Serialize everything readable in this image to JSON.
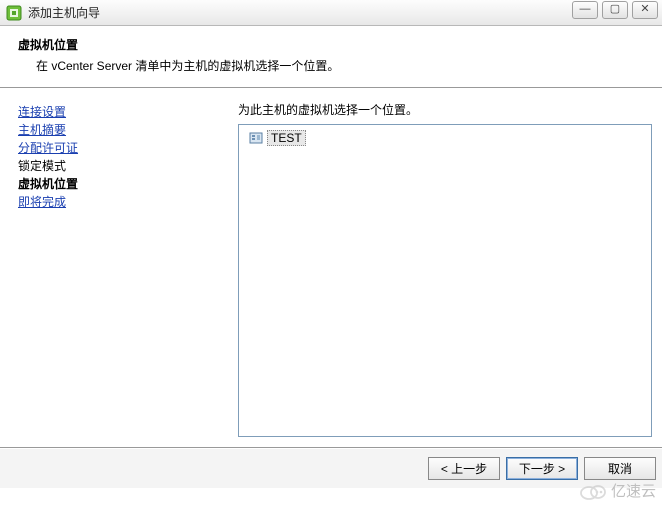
{
  "window": {
    "title": "添加主机向导",
    "controls": {
      "min": "—",
      "max": "▢",
      "close": "✕"
    }
  },
  "header": {
    "title": "虚拟机位置",
    "desc": "在 vCenter Server 清单中为主机的虚拟机选择一个位置。"
  },
  "sidebar": {
    "steps": [
      {
        "label": "连接设置",
        "state": "link"
      },
      {
        "label": "主机摘要",
        "state": "link"
      },
      {
        "label": "分配许可证",
        "state": "link"
      },
      {
        "label": "锁定模式",
        "state": "plain"
      },
      {
        "label": "虚拟机位置",
        "state": "current"
      },
      {
        "label": "即将完成",
        "state": "link"
      }
    ]
  },
  "main": {
    "prompt": "为此主机的虚拟机选择一个位置。",
    "tree": {
      "root": {
        "label": "TEST",
        "icon": "datacenter-icon",
        "selected": true
      }
    }
  },
  "footer": {
    "back": "< 上一步",
    "next": "下一步 >",
    "cancel": "取消"
  },
  "watermark": {
    "text": "亿速云"
  }
}
